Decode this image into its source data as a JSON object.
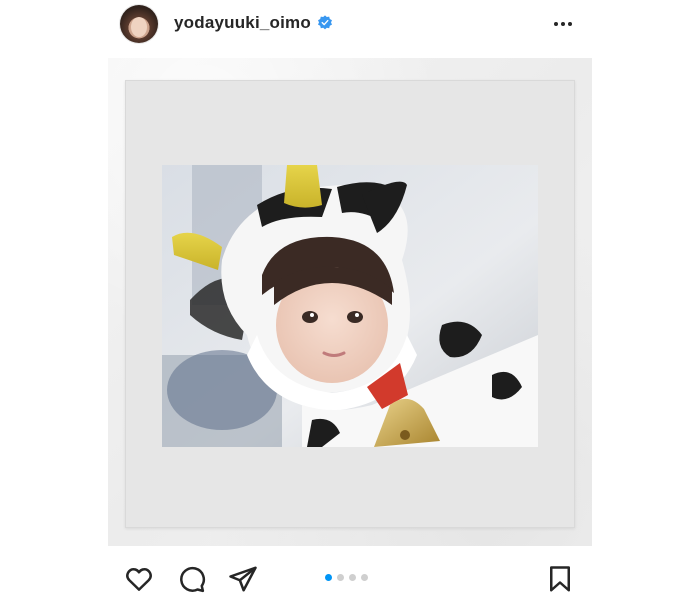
{
  "post": {
    "username": "yodayuuki_oimo",
    "verified": true,
    "avatar_icon": "avatar-photo",
    "more_icon": "more-horizontal-icon"
  },
  "media": {
    "type": "photo-in-polaroid-frame",
    "carousel": {
      "total": 4,
      "active_index": 0
    }
  },
  "actions": {
    "like_icon": "heart-outline-icon",
    "comment_icon": "comment-bubble-icon",
    "share_icon": "paper-plane-icon",
    "save_icon": "bookmark-outline-icon"
  },
  "colors": {
    "text": "#262626",
    "verified_badge": "#3897f0",
    "active_dot": "#0095f6",
    "inactive_dot": "#cfcfcf",
    "frame_background": "#e6e6e6"
  }
}
